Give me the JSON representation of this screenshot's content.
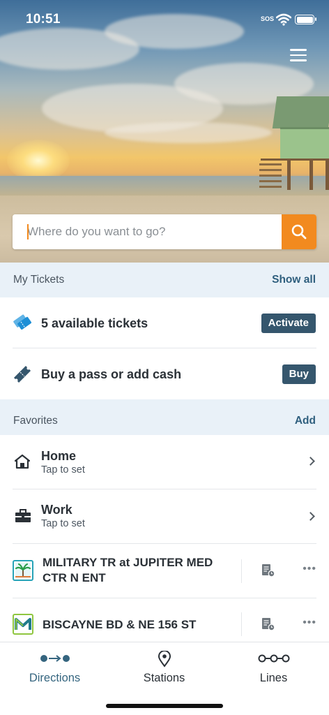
{
  "status": {
    "time": "10:51",
    "sos": "SOS"
  },
  "search": {
    "placeholder": "Where do you want to go?"
  },
  "tickets": {
    "header": "My Tickets",
    "show_all": "Show all",
    "available": {
      "label": "5 available tickets",
      "action": "Activate"
    },
    "buy": {
      "label": "Buy a pass or add cash",
      "action": "Buy"
    }
  },
  "favorites": {
    "header": "Favorites",
    "add": "Add",
    "items": [
      {
        "title": "Home",
        "subtitle": "Tap to set",
        "icon": "home-icon"
      },
      {
        "title": "Work",
        "subtitle": "Tap to set",
        "icon": "briefcase-icon"
      }
    ],
    "stops": [
      {
        "title": "MILITARY TR at JUPITER MED CTR N ENT",
        "icon": "palm-route-icon"
      },
      {
        "title": "BISCAYNE BD & NE 156 ST",
        "icon": "m-route-icon"
      }
    ]
  },
  "tabs": [
    {
      "label": "Directions",
      "icon": "directions-icon",
      "active": true
    },
    {
      "label": "Stations",
      "icon": "location-pin-icon",
      "active": false
    },
    {
      "label": "Lines",
      "icon": "lines-icon",
      "active": false
    }
  ],
  "colors": {
    "accent": "#f28a1f",
    "primary": "#35566d",
    "section_bg": "#e9f1f8",
    "ticket_blue": "#1e8fd6"
  }
}
